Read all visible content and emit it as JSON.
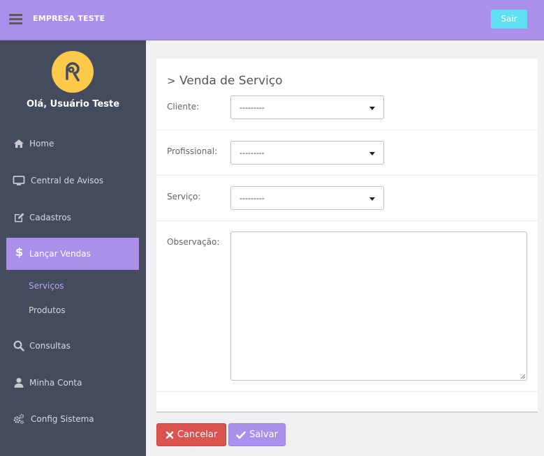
{
  "header": {
    "brand": "EMPRESA TESTE",
    "logout_label": "Sair"
  },
  "user": {
    "greeting": "Olá, Usuário Teste"
  },
  "sidebar": {
    "items": [
      {
        "label": "Home",
        "icon": "home-icon"
      },
      {
        "label": "Central de Avisos",
        "icon": "monitor-icon"
      },
      {
        "label": "Cadastros",
        "icon": "edit-icon"
      },
      {
        "label": "Lançar Vendas",
        "icon": "dollar-icon",
        "active": true
      },
      {
        "label": "Consultas",
        "icon": "search-icon"
      },
      {
        "label": "Minha Conta",
        "icon": "user-icon"
      },
      {
        "label": "Config Sistema",
        "icon": "gears-icon"
      }
    ],
    "subitems": [
      {
        "label": "Serviços",
        "active": true
      },
      {
        "label": "Produtos"
      }
    ]
  },
  "form": {
    "title": "Venda de Serviço",
    "fields": {
      "cliente": {
        "label": "Cliente:",
        "value": "---------"
      },
      "profissional": {
        "label": "Profissional:",
        "value": "---------"
      },
      "servico": {
        "label": "Serviço:",
        "value": "---------"
      },
      "observacao": {
        "label": "Observação:",
        "value": ""
      }
    }
  },
  "actions": {
    "cancel_label": "Cancelar",
    "save_label": "Salvar"
  },
  "colors": {
    "accent": "#aa90ea",
    "sidebar_bg": "#434b5d",
    "logout_button": "#5fe0f0",
    "cancel_button": "#d9534f",
    "avatar_bg": "#fcc94a"
  }
}
